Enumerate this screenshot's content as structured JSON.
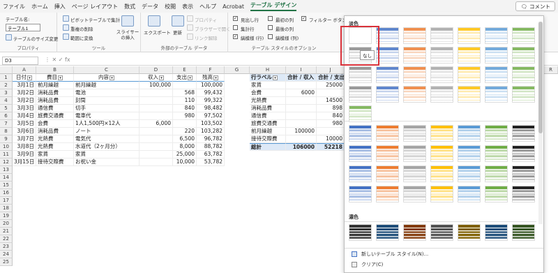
{
  "menubar": {
    "items": [
      "ファイル",
      "ホーム",
      "挿入",
      "ページ レイアウト",
      "数式",
      "データ",
      "校閲",
      "表示",
      "ヘルプ",
      "Acrobat",
      "テーブル デザイン"
    ],
    "active_index": 10,
    "comment_label": "コメント"
  },
  "ribbon": {
    "props": {
      "tname_label": "テーブル名:",
      "tname_value": "テーブル1",
      "resize_label": "テーブルのサイズ変更",
      "group_label": "プロパティ"
    },
    "tools": {
      "pivot_label": "ピボットテーブルで集計",
      "dedupe_label": "重複の削除",
      "convert_label": "範囲に変換",
      "slicer_label": "スライサーの挿入",
      "group_label": "ツール"
    },
    "external": {
      "export_label": "エクスポート",
      "refresh_label": "更新",
      "properties_label": "プロパティ",
      "browser_label": "ブラウザーで開く",
      "unlink_label": "リンク解除",
      "group_label": "外部のテーブル データ"
    },
    "style_options": {
      "header_row": "見出し行",
      "total_row": "集計行",
      "banded_rows": "縞模様 (行)",
      "first_col": "最初の列",
      "last_col": "最後の列",
      "banded_cols": "縞模様 (列)",
      "filter_btn": "フィルター ボタン",
      "group_label": "テーブル スタイルのオプション",
      "checked": {
        "header_row": true,
        "total_row": false,
        "banded_rows": true,
        "first_col": false,
        "last_col": false,
        "banded_cols": false,
        "filter_btn": true
      }
    }
  },
  "formula_bar": {
    "name_box": "D3",
    "icons": "⋮  ✕  ✓  fx"
  },
  "columns": [
    "A",
    "B",
    "C",
    "D",
    "E",
    "F",
    "G",
    "H",
    "I",
    "J",
    "R"
  ],
  "rows": [
    "1",
    "2",
    "3",
    "4",
    "5",
    "6",
    "7",
    "8",
    "9",
    "10",
    "11",
    "12",
    "13",
    "14",
    "15",
    "16",
    "17",
    "18",
    "19",
    "20",
    "21",
    "22",
    "23",
    "24",
    "25"
  ],
  "table": {
    "headers": [
      "日付",
      "費目",
      "内容",
      "収入",
      "支出",
      "残高"
    ],
    "rows": [
      [
        "3月1日",
        "前月繰越",
        "前月繰越",
        "100,000",
        "",
        "100,000"
      ],
      [
        "3月2日",
        "消耗品費",
        "電池",
        "",
        "568",
        "99,432"
      ],
      [
        "3月2日",
        "消耗品費",
        "封筒",
        "",
        "110",
        "99,322"
      ],
      [
        "3月3日",
        "通信費",
        "切手",
        "",
        "840",
        "98,482"
      ],
      [
        "3月4日",
        "旅費交通費",
        "電車代",
        "",
        "980",
        "97,502"
      ],
      [
        "3月5日",
        "会費",
        "1人1,500円×12人",
        "6,000",
        "",
        "103,502"
      ],
      [
        "3月6日",
        "消耗品費",
        "ノート",
        "",
        "220",
        "103,282"
      ],
      [
        "3月7日",
        "光熱費",
        "電気代",
        "",
        "6,500",
        "96,782"
      ],
      [
        "3月8日",
        "光熱費",
        "水道代（2ヶ月分）",
        "",
        "8,000",
        "88,782"
      ],
      [
        "3月9日",
        "家賃",
        "家賃",
        "",
        "25,000",
        "63,782"
      ],
      [
        "3月15日",
        "接待交際費",
        "お祝い金",
        "",
        "10,000",
        "53,782"
      ]
    ]
  },
  "pivot": {
    "headers": [
      "行ラベル",
      "合計 / 収入",
      "合計 / 支出"
    ],
    "rows": [
      [
        "家賃",
        "",
        "25000"
      ],
      [
        "会費",
        "6000",
        ""
      ],
      [
        "光熱費",
        "",
        "14500"
      ],
      [
        "消耗品費",
        "",
        "898"
      ],
      [
        "通信費",
        "",
        "840"
      ],
      [
        "旅費交通費",
        "",
        "980"
      ],
      [
        "前月繰越",
        "100000",
        ""
      ],
      [
        "接待交際費",
        "",
        "10000"
      ]
    ],
    "total": [
      "総計",
      "106000",
      "52218"
    ]
  },
  "gallery": {
    "sections": [
      "淡色",
      "中間",
      "濃色"
    ],
    "tooltip": "なし",
    "new_style_label": "新しいテーブル スタイル(N)...",
    "clear_label": "クリア(C)",
    "light_colors": [
      "#888888",
      "#4472c4",
      "#ed7d31",
      "#a5a5a5",
      "#ffc000",
      "#5b9bd5",
      "#70ad47"
    ],
    "medium_colors": [
      "#4472c4",
      "#ed7d31",
      "#a5a5a5",
      "#ffc000",
      "#5b9bd5",
      "#70ad47",
      "#222222"
    ],
    "dark_colors": [
      "#333333",
      "#1f4e79",
      "#843c0c",
      "#525252",
      "#7f6000",
      "#1f4e79",
      "#375623"
    ],
    "accent_red": "#d9323a"
  }
}
